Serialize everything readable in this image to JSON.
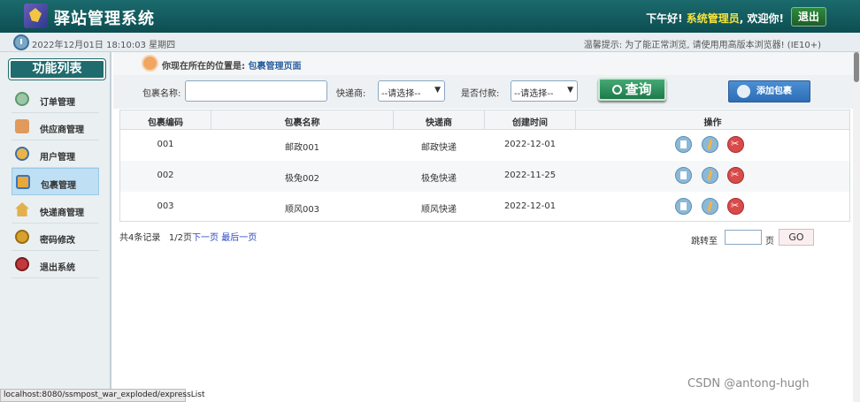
{
  "header": {
    "app_title": "驿站管理系统",
    "greeting": "下午好!",
    "user": "系统管理员",
    "welcome": ", 欢迎你!",
    "logout": "退出"
  },
  "subbar": {
    "datetime": "2022年12月01日 18:10:03 星期四",
    "notice": "温馨提示: 为了能正常浏览, 请使用用高版本浏览器! (IE10+)"
  },
  "sidebar": {
    "title": "功能列表",
    "items": [
      {
        "label": "订单管理",
        "icon": "order-icon"
      },
      {
        "label": "供应商管理",
        "icon": "truck-icon"
      },
      {
        "label": "用户管理",
        "icon": "user-icon"
      },
      {
        "label": "包裹管理",
        "icon": "package-icon",
        "active": true
      },
      {
        "label": "快递商管理",
        "icon": "house-icon"
      },
      {
        "label": "密码修改",
        "icon": "key-icon"
      },
      {
        "label": "退出系统",
        "icon": "exit-icon"
      }
    ]
  },
  "breadcrumb": {
    "prefix": "你现在所在的位置是:",
    "current": "包裹管理页面"
  },
  "search": {
    "name_label": "包裹名称:",
    "name_value": "",
    "courier_label": "快递商:",
    "courier_selected": "--请选择--",
    "paid_label": "是否付款:",
    "paid_selected": "--请选择--",
    "query_button": "查询",
    "add_button": "添加包裹"
  },
  "table": {
    "headers": [
      "包裹编码",
      "包裹名称",
      "快递商",
      "创建时间",
      "操作"
    ],
    "rows": [
      {
        "code": "001",
        "name": "邮政001",
        "courier": "邮政快递",
        "created": "2022-12-01"
      },
      {
        "code": "002",
        "name": "极兔002",
        "courier": "极兔快递",
        "created": "2022-11-25"
      },
      {
        "code": "003",
        "name": "顺风003",
        "courier": "顺风快递",
        "created": "2022-12-01"
      }
    ]
  },
  "pager": {
    "total": "共4条记录",
    "page": "1/2页",
    "next": "下一页",
    "last": "最后一页",
    "jump_label": "跳转至",
    "page_unit": "页",
    "go": "GO"
  },
  "statusbar": "localhost:8080/ssmpost_war_exploded/expressList",
  "watermark": "CSDN @antong-hugh"
}
